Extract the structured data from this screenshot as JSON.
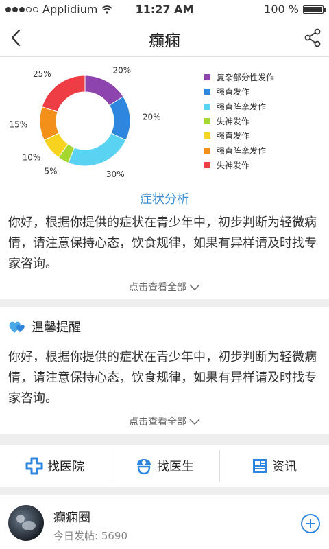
{
  "status_bar": {
    "carrier": "Applidium",
    "time": "11:27 AM",
    "battery": "100 %",
    "battery_level": 1.0
  },
  "nav": {
    "title": "癫痫",
    "back_icon": "chevron-left-icon",
    "share_icon": "share-icon"
  },
  "chart_data": {
    "type": "pie",
    "donut": true,
    "labels": [
      "复杂部分性发作",
      "强直发作",
      "强直阵挛发作",
      "失神发作",
      "强直发作",
      "强直阵挛发作",
      "失神发作"
    ],
    "values": [
      20,
      20,
      30,
      5,
      10,
      15,
      25
    ],
    "value_labels": [
      "20%",
      "20%",
      "30%",
      "5%",
      "10%",
      "15%",
      "25%"
    ],
    "colors": [
      "#8e44ad",
      "#2e86de",
      "#5ad3f2",
      "#a6d630",
      "#f7d31f",
      "#f39019",
      "#ef3d46"
    ],
    "legend_position": "right"
  },
  "analysis": {
    "title": "症状分析",
    "text": "你好，根据你提供的症状在青少年中，初步判断为轻微病情，请注意保持心态，饮食规律，如果有异样请及时找专家咨询。",
    "more": "点击查看全部"
  },
  "tips": {
    "title": "温馨提醒",
    "icon": "heart-icon",
    "text": "你好，根据你提供的症状在青少年中，初步判断为轻微病情，请注意保持心态，饮食规律，如果有异样请及时找专家咨询。",
    "more": "点击查看全部"
  },
  "actions": [
    {
      "label": "找医院",
      "icon": "hospital-cross-icon"
    },
    {
      "label": "找医生",
      "icon": "doctor-icon"
    },
    {
      "label": "资讯",
      "icon": "news-icon"
    }
  ],
  "circle": {
    "name": "癫痫圈",
    "posts_label": "今日发帖:",
    "posts_count": "5690",
    "add_icon": "plus-circle-icon"
  },
  "colors": {
    "accent": "#3a8fd4",
    "divider": "#eeeeef"
  }
}
